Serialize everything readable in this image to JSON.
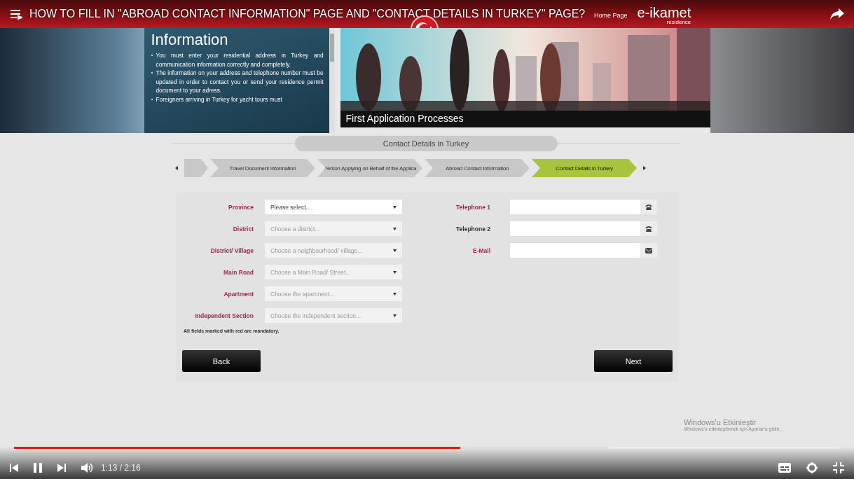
{
  "video": {
    "title": "HOW TO FILL IN \"ABROAD CONTACT INFORMATION\" PAGE AND \"CONTACT DETAILS IN TURKEY\" PAGE?",
    "playing": true,
    "time": "1:13 / 2:16",
    "progress": {
      "level": 0.54
    },
    "buffer": {
      "level": 0.72
    }
  },
  "header": {
    "home_link": "Home Page",
    "logo": "e-ikamet",
    "logo_sub": "residence"
  },
  "info": {
    "title": "Information",
    "bullets": [
      "You must enter your residential address in Turkey and communication information correctly and completely.",
      "The information on your address and telephone number must be updated in order to contact you or send your residence permit document to your adress.",
      "Foreigners arriving in Turkey for yacht tours must"
    ]
  },
  "banner": {
    "caption": "First Application Processes"
  },
  "section_title": "Contact Details in Turkey",
  "steps": [
    {
      "selected": false
    },
    {
      "label": "Travel Document Information",
      "selected": false
    },
    {
      "label": "Person Applying on Behalf of the Applica",
      "selected": false
    },
    {
      "label": "Abroad Contact Information",
      "selected": false
    },
    {
      "label": "Contact Details in Turkey",
      "selected": true
    }
  ],
  "address_fields": [
    {
      "label": "Province",
      "placeholder": "Please select...",
      "disabled": false
    },
    {
      "label": "District",
      "placeholder": "Choose a district...",
      "disabled": true
    },
    {
      "label": "District/ Village",
      "placeholder": "Choose a neighbourhood/ village...",
      "disabled": true
    },
    {
      "label": "Main Road",
      "placeholder": "Choose a Main Road/ Street...",
      "disabled": true
    },
    {
      "label": "Apartment",
      "placeholder": "Choose the apartment...",
      "disabled": true
    },
    {
      "label": "Independent Section",
      "placeholder": "Choose the independent section...",
      "disabled": true
    }
  ],
  "contact_fields": [
    {
      "label": "Telephone 1",
      "kind": "phone",
      "required": true
    },
    {
      "label": "Telephone 2",
      "kind": "phone",
      "required": false
    },
    {
      "label": "E-Mail",
      "kind": "mail",
      "required": true
    }
  ],
  "note": "All fields marked with red are mandatory.",
  "buttons": {
    "back": "Back",
    "next": "Next"
  },
  "os_notice": {
    "title": "Windows'u Etkinleştir",
    "text": "Windows'u etkinleştirmek için Ayarlar'a gidin."
  }
}
